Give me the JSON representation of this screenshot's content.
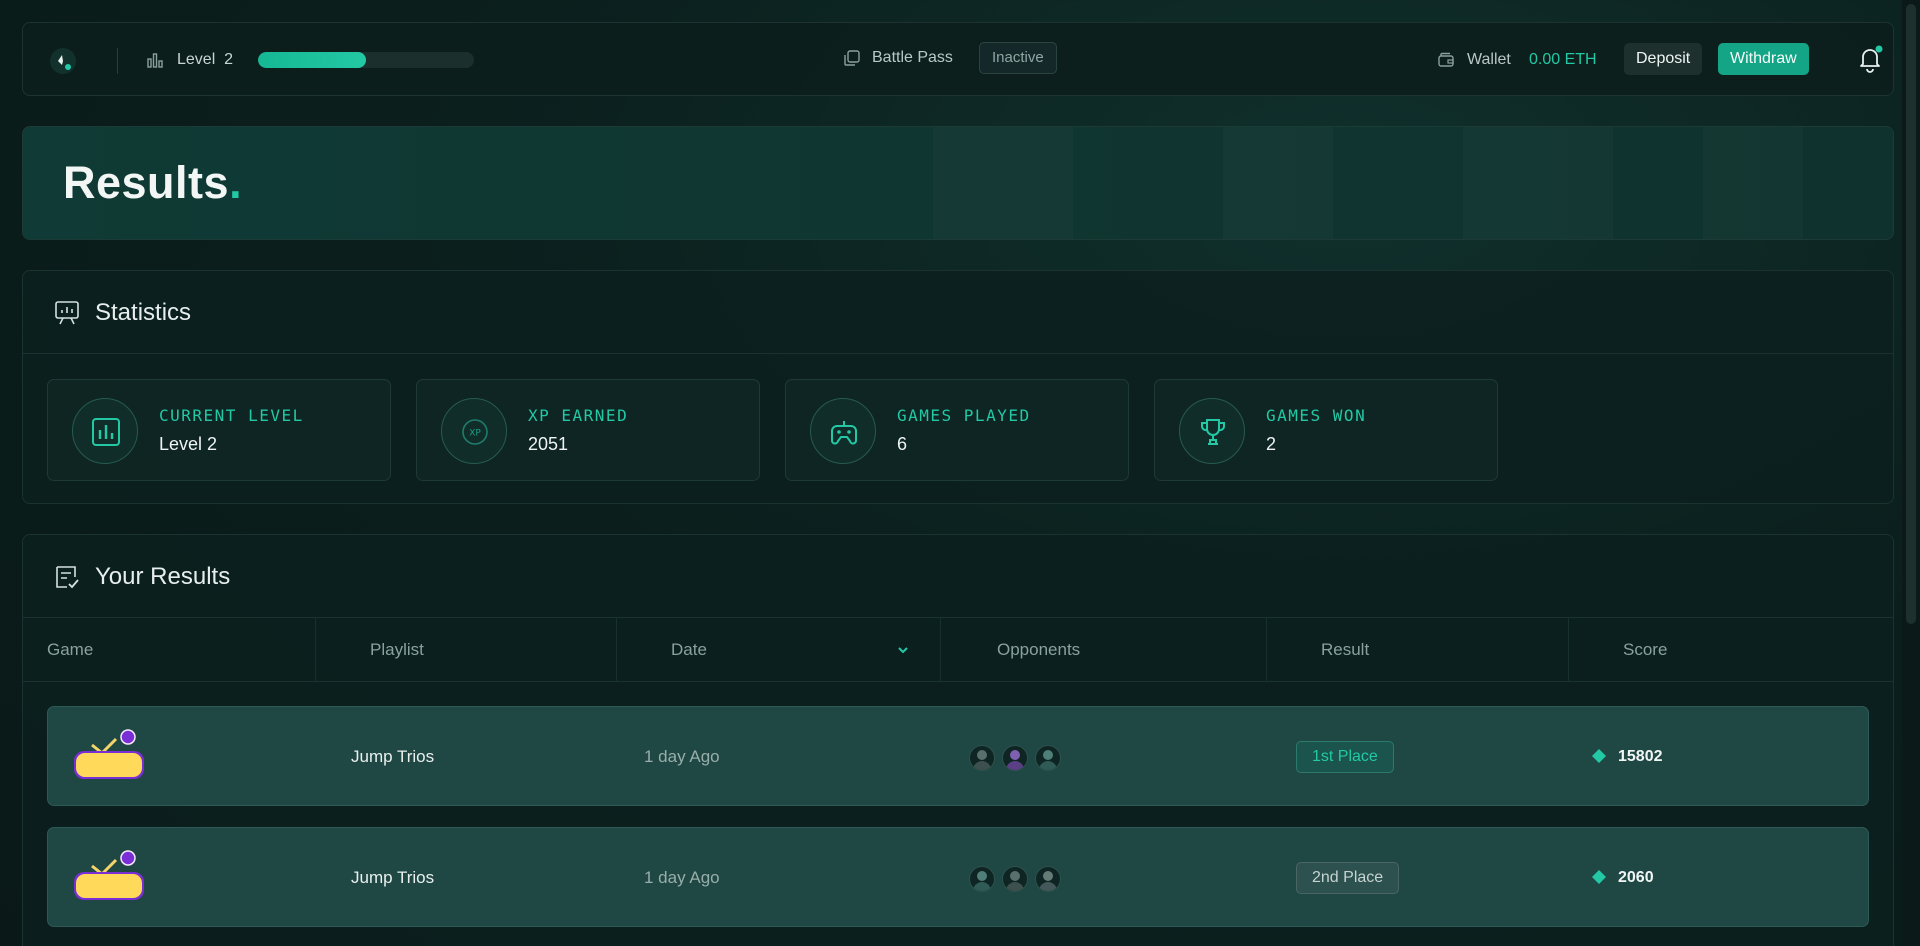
{
  "topbar": {
    "level_label": "Level  2",
    "xp_progress_percent": 50,
    "battle_pass_label": "Battle Pass",
    "battle_pass_status": "Inactive",
    "wallet_label": "Wallet",
    "wallet_amount": "0.00 ETH",
    "deposit_label": "Deposit",
    "withdraw_label": "Withdraw",
    "notification_dot_color": "#22c9a4"
  },
  "hero": {
    "title": "Results",
    "title_dot": "."
  },
  "statistics": {
    "title": "Statistics",
    "cards": [
      {
        "label": "Current Level",
        "value": "Level 2",
        "icon": "bar-chart-icon"
      },
      {
        "label": "XP Earned",
        "value": "2051",
        "icon": "xp-icon"
      },
      {
        "label": "Games Played",
        "value": "6",
        "icon": "gamepad-icon"
      },
      {
        "label": "Games Won",
        "value": "2",
        "icon": "trophy-icon"
      }
    ]
  },
  "results": {
    "title": "Your Results",
    "columns": [
      "Game",
      "Playlist",
      "Date",
      "Opponents",
      "Result",
      "Score"
    ],
    "rows": [
      {
        "playlist": "Jump Trios",
        "date": "1 day Ago",
        "result": "1st Place",
        "score": "15802"
      },
      {
        "playlist": "Jump Trios",
        "date": "1 day Ago",
        "result": "2nd Place",
        "score": "2060"
      }
    ]
  },
  "colors": {
    "accent": "#22c9a4",
    "background": "#0b1f1d",
    "row": "#1f4744"
  }
}
